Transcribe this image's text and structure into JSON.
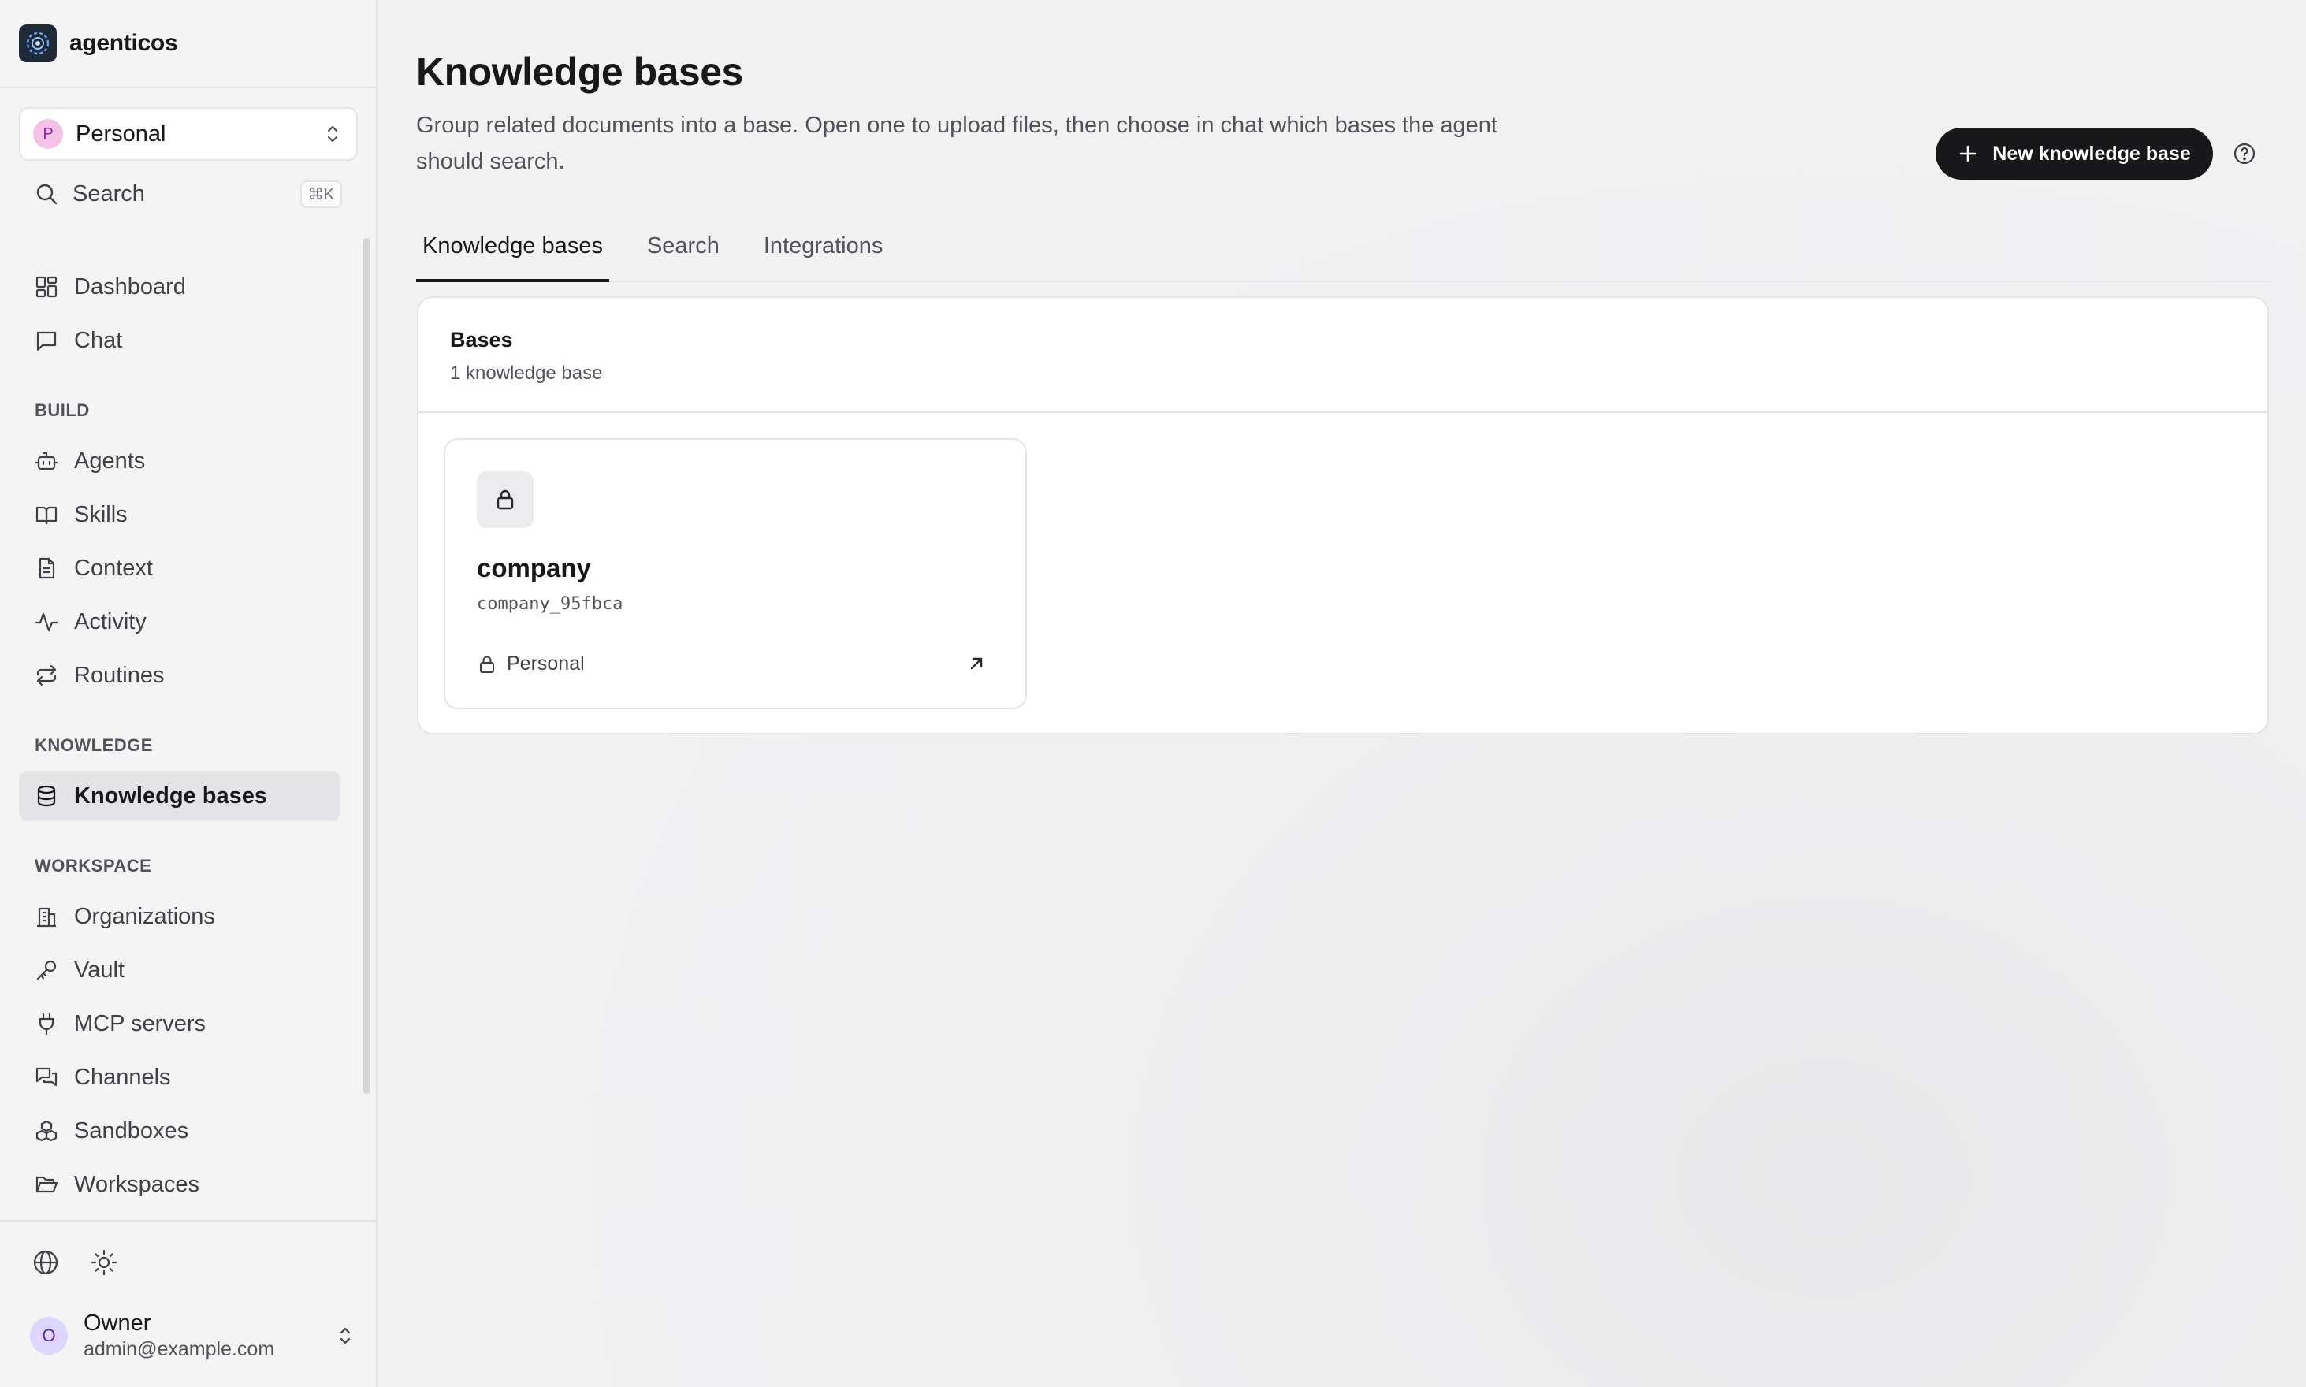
{
  "app": {
    "name": "agenticos"
  },
  "workspace": {
    "name": "Personal",
    "initial": "P"
  },
  "search": {
    "label": "Search",
    "shortcut": "⌘K"
  },
  "nav": {
    "top": [
      {
        "label": "Dashboard",
        "icon": "dashboard-icon"
      },
      {
        "label": "Chat",
        "icon": "chat-icon"
      }
    ],
    "build": {
      "label": "BUILD",
      "items": [
        {
          "label": "Agents",
          "icon": "bot-icon"
        },
        {
          "label": "Skills",
          "icon": "book-icon"
        },
        {
          "label": "Context",
          "icon": "file-icon"
        },
        {
          "label": "Activity",
          "icon": "activity-icon"
        },
        {
          "label": "Routines",
          "icon": "repeat-icon"
        }
      ]
    },
    "knowledge": {
      "label": "KNOWLEDGE",
      "items": [
        {
          "label": "Knowledge bases",
          "icon": "database-icon",
          "active": true
        }
      ]
    },
    "workspace": {
      "label": "WORKSPACE",
      "items": [
        {
          "label": "Organizations",
          "icon": "building-icon"
        },
        {
          "label": "Vault",
          "icon": "key-icon"
        },
        {
          "label": "MCP servers",
          "icon": "plug-icon"
        },
        {
          "label": "Channels",
          "icon": "messages-icon"
        },
        {
          "label": "Sandboxes",
          "icon": "boxes-icon"
        },
        {
          "label": "Workspaces",
          "icon": "folder-icon"
        }
      ]
    }
  },
  "user": {
    "name": "Owner",
    "email": "admin@example.com",
    "initial": "O"
  },
  "page": {
    "title": "Knowledge bases",
    "subtitle": "Group related documents into a base. Open one to upload files, then choose in chat which bases the agent should search.",
    "new_button": "New knowledge base",
    "tabs": [
      "Knowledge bases",
      "Search",
      "Integrations"
    ],
    "active_tab": "Knowledge bases"
  },
  "bases": {
    "title": "Bases",
    "count_label": "1 knowledge base",
    "items": [
      {
        "name": "company",
        "id": "company_95fbca",
        "scope": "Personal"
      }
    ]
  }
}
